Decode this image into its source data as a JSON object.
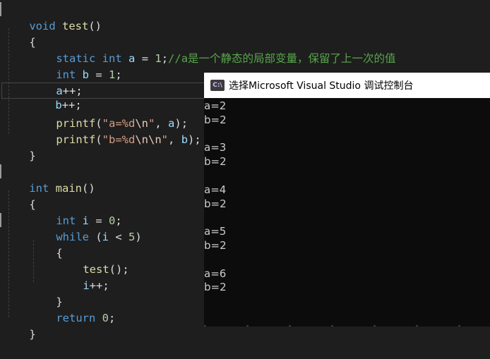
{
  "code": {
    "line1": {
      "kw": "void",
      "fn": "test",
      "rest": "()"
    },
    "line2": "{",
    "line3": {
      "kw1": "static",
      "kw2": "int",
      "var": "a",
      "op": " = ",
      "num": "1",
      "semi": ";",
      "comment": "//a是一个静态的局部变量，保留了上一次的值"
    },
    "line4": {
      "kw": "int",
      "var": "b",
      "op": " = ",
      "num": "1",
      "semi": ";"
    },
    "line5": {
      "var": "a",
      "op": "++;"
    },
    "line6": {
      "var": "b",
      "op": "++;"
    },
    "line7": {
      "fn": "printf",
      "open": "(",
      "str1": "\"a=%d",
      "esc": "\\n",
      "str2": "\"",
      "mid": ", ",
      "var": "a",
      "close": ");"
    },
    "line8": {
      "fn": "printf",
      "open": "(",
      "str1": "\"b=%d",
      "esc": "\\n\\n",
      "str2": "\"",
      "mid": ", ",
      "var": "b",
      "close": ");"
    },
    "line9": "}",
    "line10": {
      "kw": "int",
      "fn": "main",
      "rest": "()"
    },
    "line11": "{",
    "line12": {
      "kw": "int",
      "var": "i",
      "op": " = ",
      "num": "0",
      "semi": ";"
    },
    "line13": {
      "kw": "while",
      "open": " (",
      "var": "i",
      "op": " < ",
      "num": "5",
      "close": ")"
    },
    "line14": "{",
    "line15": {
      "fn": "test",
      "rest": "();"
    },
    "line16": {
      "var": "i",
      "op": "++;"
    },
    "line17": "}",
    "line18": {
      "kw": "return",
      "num": "0",
      "semi": ";"
    },
    "line19": "}"
  },
  "console": {
    "icon_label": "C:\\",
    "title": "选择Microsoft Visual Studio 调试控制台",
    "lines": [
      "a=2",
      "b=2",
      "",
      "a=3",
      "b=2",
      "",
      "a=4",
      "b=2",
      "",
      "a=5",
      "b=2",
      "",
      "a=6",
      "b=2"
    ]
  },
  "colors": {
    "editor_bg": "#1e1e1e",
    "keyword": "#569cd6",
    "function": "#dcdcaa",
    "variable": "#9cdcfe",
    "number": "#b5cea8",
    "string": "#d69d85",
    "comment": "#57a64a",
    "console_bg": "#0c0c0c",
    "console_text": "#cccccc"
  }
}
